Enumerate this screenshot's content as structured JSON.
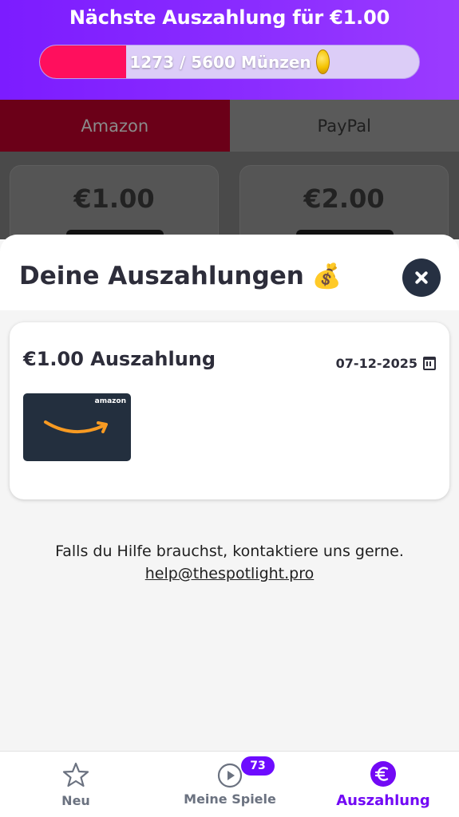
{
  "header": {
    "title": "Nächste Auszahlung für €1.00",
    "progress_text": "1273 / 5600 Münzen",
    "progress_current": 1273,
    "progress_total": 5600,
    "progress_fraction": 0.227,
    "coin_icon": "coin-icon"
  },
  "tabs": [
    {
      "label": "Amazon"
    },
    {
      "label": "PayPal"
    }
  ],
  "reward_cards": [
    {
      "amount": "€1.00"
    },
    {
      "amount": "€2.00"
    }
  ],
  "sheet": {
    "title": "Deine Auszahlungen",
    "title_icon": "💰",
    "close_icon": "close-icon"
  },
  "payout": {
    "title": "€1.00 Auszahlung",
    "date": "07-12-2025",
    "provider_logo_text": "amazon"
  },
  "help": {
    "text": "Falls du Hilfe brauchst, kontaktiere uns gerne.",
    "email": "help@thespotlight.pro"
  },
  "bottom_nav": {
    "items": [
      {
        "label": "Neu",
        "icon": "star-icon"
      },
      {
        "label": "Meine Spiele",
        "icon": "play-icon",
        "badge": "73"
      },
      {
        "label": "Auszahlung",
        "icon": "euro-icon"
      }
    ]
  },
  "colors": {
    "accent": "#7209f5",
    "progress_fill": "#ff0f5d",
    "close_button": "#263042"
  }
}
